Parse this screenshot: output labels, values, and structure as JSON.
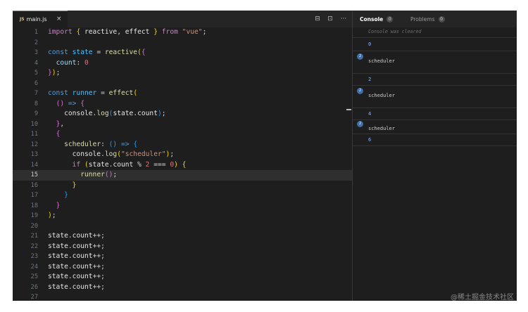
{
  "editor": {
    "tab": {
      "lang_badge": "JS",
      "filename": "main.js",
      "close": "×"
    },
    "actions": {
      "split": "⊟",
      "panel": "⊡",
      "more": "···"
    },
    "current_line": 15,
    "lines": [
      [
        [
          "k",
          "import "
        ],
        [
          "b1",
          "{ "
        ],
        [
          "v",
          "reactive"
        ],
        [
          "p",
          ", "
        ],
        [
          "v",
          "effect "
        ],
        [
          "b1",
          "} "
        ],
        [
          "k",
          "from "
        ],
        [
          "s",
          "\"vue\""
        ],
        [
          "p",
          ";"
        ]
      ],
      [],
      [
        [
          "kw",
          "const "
        ],
        [
          "ob",
          "state "
        ],
        [
          "p",
          "= "
        ],
        [
          "f",
          "reactive"
        ],
        [
          "b1",
          "("
        ],
        [
          "b2",
          "{"
        ]
      ],
      [
        [
          "p",
          "  "
        ],
        [
          "pr",
          "count"
        ],
        [
          "p",
          ": "
        ],
        [
          "n",
          "0"
        ]
      ],
      [
        [
          "b2",
          "}"
        ],
        [
          "b1",
          ")"
        ],
        [
          "p",
          ";"
        ]
      ],
      [],
      [
        [
          "kw",
          "const "
        ],
        [
          "ob",
          "runner "
        ],
        [
          "p",
          "= "
        ],
        [
          "f",
          "effect"
        ],
        [
          "b1",
          "("
        ]
      ],
      [
        [
          "p",
          "  "
        ],
        [
          "b2",
          "()"
        ],
        [
          "p",
          " "
        ],
        [
          "kw",
          "=> "
        ],
        [
          "b2",
          "{"
        ]
      ],
      [
        [
          "p",
          "    "
        ],
        [
          "v",
          "console"
        ],
        [
          "p",
          "."
        ],
        [
          "f",
          "log"
        ],
        [
          "b3",
          "("
        ],
        [
          "v",
          "state"
        ],
        [
          "p",
          "."
        ],
        [
          "v",
          "count"
        ],
        [
          "b3",
          ")"
        ],
        [
          "p",
          ";"
        ]
      ],
      [
        [
          "p",
          "  "
        ],
        [
          "b2",
          "}"
        ],
        [
          "p",
          ","
        ]
      ],
      [
        [
          "p",
          "  "
        ],
        [
          "b2",
          "{"
        ]
      ],
      [
        [
          "p",
          "    "
        ],
        [
          "f",
          "scheduler"
        ],
        [
          "p",
          ": "
        ],
        [
          "b3",
          "()"
        ],
        [
          "p",
          " "
        ],
        [
          "kw",
          "=> "
        ],
        [
          "b3",
          "{"
        ]
      ],
      [
        [
          "p",
          "      "
        ],
        [
          "v",
          "console"
        ],
        [
          "p",
          "."
        ],
        [
          "f",
          "log"
        ],
        [
          "b1",
          "("
        ],
        [
          "s",
          "\"scheduler\""
        ],
        [
          "b1",
          ")"
        ],
        [
          "p",
          ";"
        ]
      ],
      [
        [
          "p",
          "      "
        ],
        [
          "k",
          "if "
        ],
        [
          "b1",
          "("
        ],
        [
          "v",
          "state"
        ],
        [
          "p",
          "."
        ],
        [
          "v",
          "count "
        ],
        [
          "p",
          "% "
        ],
        [
          "n",
          "2 "
        ],
        [
          "p",
          "=== "
        ],
        [
          "n",
          "0"
        ],
        [
          "b1",
          ")"
        ],
        [
          "p",
          " "
        ],
        [
          "b1",
          "{"
        ]
      ],
      [
        [
          "p",
          "        "
        ],
        [
          "f",
          "runner"
        ],
        [
          "b2",
          "()"
        ],
        [
          "p",
          ";"
        ]
      ],
      [
        [
          "p",
          "      "
        ],
        [
          "b1",
          "}"
        ]
      ],
      [
        [
          "p",
          "    "
        ],
        [
          "b3",
          "}"
        ]
      ],
      [
        [
          "p",
          "  "
        ],
        [
          "b2",
          "}"
        ]
      ],
      [
        [
          "b1",
          ")"
        ],
        [
          "p",
          ";"
        ]
      ],
      [],
      [
        [
          "v",
          "state"
        ],
        [
          "p",
          "."
        ],
        [
          "v",
          "count"
        ],
        [
          "p",
          "++;"
        ]
      ],
      [
        [
          "v",
          "state"
        ],
        [
          "p",
          "."
        ],
        [
          "v",
          "count"
        ],
        [
          "p",
          "++;"
        ]
      ],
      [
        [
          "v",
          "state"
        ],
        [
          "p",
          "."
        ],
        [
          "v",
          "count"
        ],
        [
          "p",
          "++;"
        ]
      ],
      [
        [
          "v",
          "state"
        ],
        [
          "p",
          "."
        ],
        [
          "v",
          "count"
        ],
        [
          "p",
          "++;"
        ]
      ],
      [
        [
          "v",
          "state"
        ],
        [
          "p",
          "."
        ],
        [
          "v",
          "count"
        ],
        [
          "p",
          "++;"
        ]
      ],
      [
        [
          "v",
          "state"
        ],
        [
          "p",
          "."
        ],
        [
          "v",
          "count"
        ],
        [
          "p",
          "++;"
        ]
      ],
      []
    ]
  },
  "console": {
    "tabs": [
      {
        "label": "Console",
        "count": "0"
      },
      {
        "label": "Problems",
        "count": "0"
      }
    ],
    "cleared_message": "Console was cleared",
    "entries": [
      {
        "text": "0",
        "numeric": true
      },
      {
        "text": "scheduler",
        "numeric": false,
        "repeat": "2"
      },
      {
        "text": "2",
        "numeric": true
      },
      {
        "text": "scheduler",
        "numeric": false,
        "repeat": "2"
      },
      {
        "text": "4",
        "numeric": true
      },
      {
        "text": "scheduler",
        "numeric": false,
        "repeat": "2"
      },
      {
        "text": "6",
        "numeric": true
      }
    ]
  },
  "watermark": "@稀土掘金技术社区",
  "colors": {
    "background": "#1e1e1e",
    "keyword": "#c586c0",
    "function": "#dcdcaa",
    "string": "#ce9178",
    "number": "#e2707a",
    "storage": "#569cd6",
    "accent_tab_border": "#3794ff"
  }
}
